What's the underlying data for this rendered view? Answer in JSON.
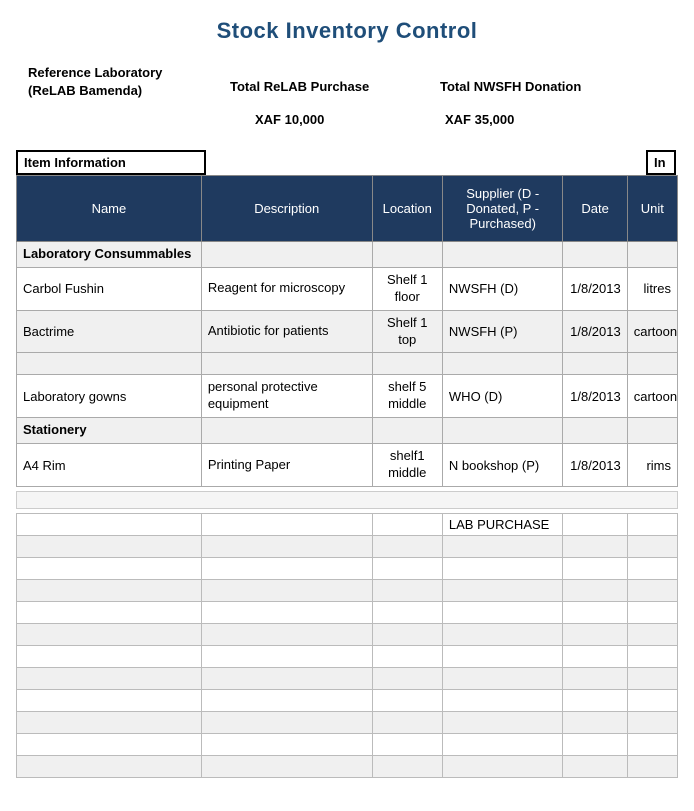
{
  "title": "Stock  Inventory Control",
  "header": {
    "reference_lab_line1": "Reference Laboratory",
    "reference_lab_line2": "(ReLAB Bamenda)",
    "total_purchase_label": "Total ReLAB Purchase",
    "total_donation_label": "Total NWSFH Donation",
    "total_purchase_amount": "XAF 10,000",
    "total_donation_amount": "XAF 35,000"
  },
  "section_labels": {
    "left": "Item Information",
    "right": "In"
  },
  "columns": {
    "name": "Name",
    "description": "Description",
    "location": "Location",
    "supplier": "Supplier (D - Donated, P - Purchased)",
    "date": "Date",
    "unit": "Unit"
  },
  "categories": [
    {
      "name": "Laboratory Consummables",
      "items": [
        {
          "name": "Carbol Fushin",
          "description": "Reagent for microscopy",
          "location": "Shelf 1 floor",
          "supplier": "NWSFH (D)",
          "date": "1/8/2013",
          "unit": "litres"
        },
        {
          "name": "Bactrime",
          "description": "Antibiotic for patients",
          "location": "Shelf 1 top",
          "supplier": "NWSFH (P)",
          "date": "1/8/2013",
          "unit": "cartoon"
        },
        {
          "name": "",
          "description": "",
          "location": "",
          "supplier": "",
          "date": "",
          "unit": ""
        },
        {
          "name": "Laboratory gowns",
          "description": "personal protective equipment",
          "location": "shelf 5 middle",
          "supplier": "WHO (D)",
          "date": "1/8/2013",
          "unit": "cartoons"
        }
      ]
    },
    {
      "name": "Stationery",
      "items": [
        {
          "name": "A4 Rim",
          "description": "Printing Paper",
          "location": "shelf1 middle",
          "supplier": "N bookshop (P)",
          "date": "1/8/2013",
          "unit": "rims"
        }
      ]
    }
  ],
  "bottom_table": {
    "header_label": "LAB PURCHASE",
    "rows": 12
  }
}
